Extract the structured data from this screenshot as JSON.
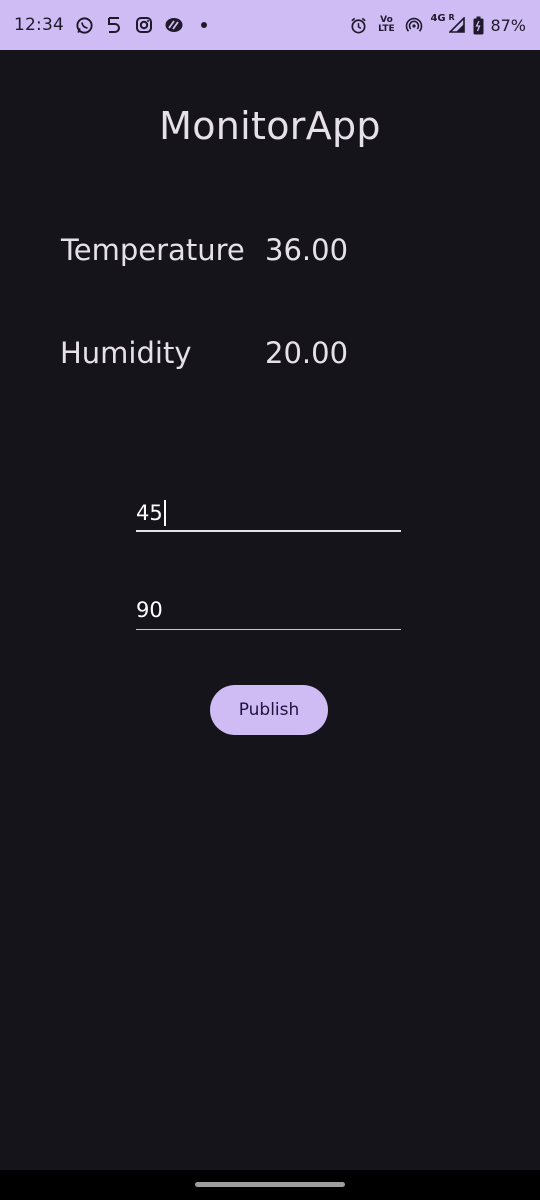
{
  "status_bar": {
    "time": "12:34",
    "left_icons": [
      "whatsapp-icon",
      "notification-5-icon",
      "instagram-icon",
      "app-icon",
      "dot-icon"
    ],
    "right_icons": [
      "alarm-icon",
      "volte-icon",
      "hotspot-icon",
      "signal-4g-icon",
      "battery-icon"
    ],
    "volte_label": "Vo LTE",
    "network_label": "4G",
    "roaming_label": "R",
    "battery": "87%",
    "background": "#cfbcf5"
  },
  "app": {
    "title": "MonitorApp",
    "temperature_label": "Temperature",
    "temperature_value": "36.00",
    "humidity_label": "Humidity",
    "humidity_value": "20.00",
    "input_1_value": "45",
    "input_2_value": "90",
    "publish_label": "Publish",
    "accent_color": "#cfbcf5",
    "background_color": "#16141b"
  }
}
